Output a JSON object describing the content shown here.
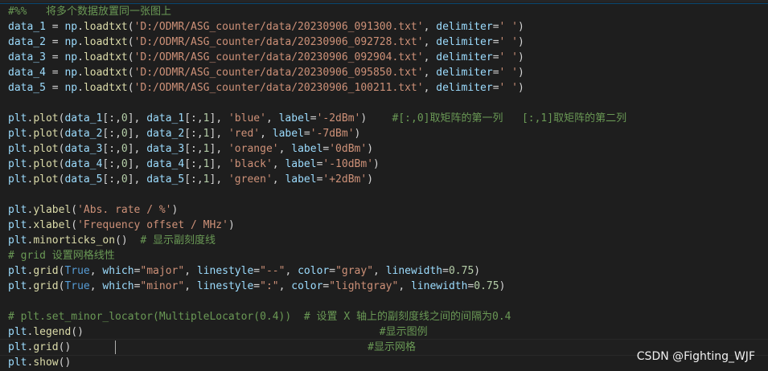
{
  "editor": {
    "lines": [
      [
        {
          "t": "#%%   将多个数据放置同一张图上",
          "c": "c"
        }
      ],
      [
        {
          "t": "data_1",
          "c": "v"
        },
        {
          "t": " = ",
          "c": "p"
        },
        {
          "t": "np",
          "c": "v"
        },
        {
          "t": ".",
          "c": "p"
        },
        {
          "t": "loadtxt",
          "c": "f"
        },
        {
          "t": "(",
          "c": "p"
        },
        {
          "t": "'D:/ODMR/ASG_counter/data/20230906_091300.txt'",
          "c": "s"
        },
        {
          "t": ", ",
          "c": "p"
        },
        {
          "t": "delimiter",
          "c": "v"
        },
        {
          "t": "=",
          "c": "p"
        },
        {
          "t": "' '",
          "c": "s"
        },
        {
          "t": ")",
          "c": "p"
        }
      ],
      [
        {
          "t": "data_2",
          "c": "v"
        },
        {
          "t": " = ",
          "c": "p"
        },
        {
          "t": "np",
          "c": "v"
        },
        {
          "t": ".",
          "c": "p"
        },
        {
          "t": "loadtxt",
          "c": "f"
        },
        {
          "t": "(",
          "c": "p"
        },
        {
          "t": "'D:/ODMR/ASG_counter/data/20230906_092728.txt'",
          "c": "s"
        },
        {
          "t": ", ",
          "c": "p"
        },
        {
          "t": "delimiter",
          "c": "v"
        },
        {
          "t": "=",
          "c": "p"
        },
        {
          "t": "' '",
          "c": "s"
        },
        {
          "t": ")",
          "c": "p"
        }
      ],
      [
        {
          "t": "data_3",
          "c": "v"
        },
        {
          "t": " = ",
          "c": "p"
        },
        {
          "t": "np",
          "c": "v"
        },
        {
          "t": ".",
          "c": "p"
        },
        {
          "t": "loadtxt",
          "c": "f"
        },
        {
          "t": "(",
          "c": "p"
        },
        {
          "t": "'D:/ODMR/ASG_counter/data/20230906_092904.txt'",
          "c": "s"
        },
        {
          "t": ", ",
          "c": "p"
        },
        {
          "t": "delimiter",
          "c": "v"
        },
        {
          "t": "=",
          "c": "p"
        },
        {
          "t": "' '",
          "c": "s"
        },
        {
          "t": ")",
          "c": "p"
        }
      ],
      [
        {
          "t": "data_4",
          "c": "v"
        },
        {
          "t": " = ",
          "c": "p"
        },
        {
          "t": "np",
          "c": "v"
        },
        {
          "t": ".",
          "c": "p"
        },
        {
          "t": "loadtxt",
          "c": "f"
        },
        {
          "t": "(",
          "c": "p"
        },
        {
          "t": "'D:/ODMR/ASG_counter/data/20230906_095850.txt'",
          "c": "s"
        },
        {
          "t": ", ",
          "c": "p"
        },
        {
          "t": "delimiter",
          "c": "v"
        },
        {
          "t": "=",
          "c": "p"
        },
        {
          "t": "' '",
          "c": "s"
        },
        {
          "t": ")",
          "c": "p"
        }
      ],
      [
        {
          "t": "data_5",
          "c": "v"
        },
        {
          "t": " = ",
          "c": "p"
        },
        {
          "t": "np",
          "c": "v"
        },
        {
          "t": ".",
          "c": "p"
        },
        {
          "t": "loadtxt",
          "c": "f"
        },
        {
          "t": "(",
          "c": "p"
        },
        {
          "t": "'D:/ODMR/ASG_counter/data/20230906_100211.txt'",
          "c": "s"
        },
        {
          "t": ", ",
          "c": "p"
        },
        {
          "t": "delimiter",
          "c": "v"
        },
        {
          "t": "=",
          "c": "p"
        },
        {
          "t": "' '",
          "c": "s"
        },
        {
          "t": ")",
          "c": "p"
        }
      ],
      [],
      [
        {
          "t": "plt",
          "c": "v"
        },
        {
          "t": ".",
          "c": "p"
        },
        {
          "t": "plot",
          "c": "f"
        },
        {
          "t": "(",
          "c": "p"
        },
        {
          "t": "data_1",
          "c": "v"
        },
        {
          "t": "[:,",
          "c": "p"
        },
        {
          "t": "0",
          "c": "n"
        },
        {
          "t": "], ",
          "c": "p"
        },
        {
          "t": "data_1",
          "c": "v"
        },
        {
          "t": "[:,",
          "c": "p"
        },
        {
          "t": "1",
          "c": "n"
        },
        {
          "t": "], ",
          "c": "p"
        },
        {
          "t": "'blue'",
          "c": "s"
        },
        {
          "t": ", ",
          "c": "p"
        },
        {
          "t": "label",
          "c": "v"
        },
        {
          "t": "=",
          "c": "p"
        },
        {
          "t": "'-2dBm'",
          "c": "s"
        },
        {
          "t": ")    ",
          "c": "p"
        },
        {
          "t": "#[:,0]取矩阵的第一列   [:,1]取矩阵的第二列",
          "c": "c"
        }
      ],
      [
        {
          "t": "plt",
          "c": "v"
        },
        {
          "t": ".",
          "c": "p"
        },
        {
          "t": "plot",
          "c": "f"
        },
        {
          "t": "(",
          "c": "p"
        },
        {
          "t": "data_2",
          "c": "v"
        },
        {
          "t": "[:,",
          "c": "p"
        },
        {
          "t": "0",
          "c": "n"
        },
        {
          "t": "], ",
          "c": "p"
        },
        {
          "t": "data_2",
          "c": "v"
        },
        {
          "t": "[:,",
          "c": "p"
        },
        {
          "t": "1",
          "c": "n"
        },
        {
          "t": "], ",
          "c": "p"
        },
        {
          "t": "'red'",
          "c": "s"
        },
        {
          "t": ", ",
          "c": "p"
        },
        {
          "t": "label",
          "c": "v"
        },
        {
          "t": "=",
          "c": "p"
        },
        {
          "t": "'-7dBm'",
          "c": "s"
        },
        {
          "t": ")",
          "c": "p"
        }
      ],
      [
        {
          "t": "plt",
          "c": "v"
        },
        {
          "t": ".",
          "c": "p"
        },
        {
          "t": "plot",
          "c": "f"
        },
        {
          "t": "(",
          "c": "p"
        },
        {
          "t": "data_3",
          "c": "v"
        },
        {
          "t": "[:,",
          "c": "p"
        },
        {
          "t": "0",
          "c": "n"
        },
        {
          "t": "], ",
          "c": "p"
        },
        {
          "t": "data_3",
          "c": "v"
        },
        {
          "t": "[:,",
          "c": "p"
        },
        {
          "t": "1",
          "c": "n"
        },
        {
          "t": "], ",
          "c": "p"
        },
        {
          "t": "'orange'",
          "c": "s"
        },
        {
          "t": ", ",
          "c": "p"
        },
        {
          "t": "label",
          "c": "v"
        },
        {
          "t": "=",
          "c": "p"
        },
        {
          "t": "'0dBm'",
          "c": "s"
        },
        {
          "t": ")",
          "c": "p"
        }
      ],
      [
        {
          "t": "plt",
          "c": "v"
        },
        {
          "t": ".",
          "c": "p"
        },
        {
          "t": "plot",
          "c": "f"
        },
        {
          "t": "(",
          "c": "p"
        },
        {
          "t": "data_4",
          "c": "v"
        },
        {
          "t": "[:,",
          "c": "p"
        },
        {
          "t": "0",
          "c": "n"
        },
        {
          "t": "], ",
          "c": "p"
        },
        {
          "t": "data_4",
          "c": "v"
        },
        {
          "t": "[:,",
          "c": "p"
        },
        {
          "t": "1",
          "c": "n"
        },
        {
          "t": "], ",
          "c": "p"
        },
        {
          "t": "'black'",
          "c": "s"
        },
        {
          "t": ", ",
          "c": "p"
        },
        {
          "t": "label",
          "c": "v"
        },
        {
          "t": "=",
          "c": "p"
        },
        {
          "t": "'-10dBm'",
          "c": "s"
        },
        {
          "t": ")",
          "c": "p"
        }
      ],
      [
        {
          "t": "plt",
          "c": "v"
        },
        {
          "t": ".",
          "c": "p"
        },
        {
          "t": "plot",
          "c": "f"
        },
        {
          "t": "(",
          "c": "p"
        },
        {
          "t": "data_5",
          "c": "v"
        },
        {
          "t": "[:,",
          "c": "p"
        },
        {
          "t": "0",
          "c": "n"
        },
        {
          "t": "], ",
          "c": "p"
        },
        {
          "t": "data_5",
          "c": "v"
        },
        {
          "t": "[:,",
          "c": "p"
        },
        {
          "t": "1",
          "c": "n"
        },
        {
          "t": "], ",
          "c": "p"
        },
        {
          "t": "'green'",
          "c": "s"
        },
        {
          "t": ", ",
          "c": "p"
        },
        {
          "t": "label",
          "c": "v"
        },
        {
          "t": "=",
          "c": "p"
        },
        {
          "t": "'+2dBm'",
          "c": "s"
        },
        {
          "t": ")",
          "c": "p"
        }
      ],
      [],
      [
        {
          "t": "plt",
          "c": "v"
        },
        {
          "t": ".",
          "c": "p"
        },
        {
          "t": "ylabel",
          "c": "f"
        },
        {
          "t": "(",
          "c": "p"
        },
        {
          "t": "'Abs. rate / %'",
          "c": "s"
        },
        {
          "t": ")",
          "c": "p"
        }
      ],
      [
        {
          "t": "plt",
          "c": "v"
        },
        {
          "t": ".",
          "c": "p"
        },
        {
          "t": "xlabel",
          "c": "f"
        },
        {
          "t": "(",
          "c": "p"
        },
        {
          "t": "'Frequency offset / MHz'",
          "c": "s"
        },
        {
          "t": ")",
          "c": "p"
        }
      ],
      [
        {
          "t": "plt",
          "c": "v"
        },
        {
          "t": ".",
          "c": "p"
        },
        {
          "t": "minorticks_on",
          "c": "f"
        },
        {
          "t": "()  ",
          "c": "p"
        },
        {
          "t": "# 显示副刻度线",
          "c": "c"
        }
      ],
      [
        {
          "t": "# grid 设置网格线性",
          "c": "c"
        }
      ],
      [
        {
          "t": "plt",
          "c": "v"
        },
        {
          "t": ".",
          "c": "p"
        },
        {
          "t": "grid",
          "c": "f"
        },
        {
          "t": "(",
          "c": "p"
        },
        {
          "t": "True",
          "c": "k"
        },
        {
          "t": ", ",
          "c": "p"
        },
        {
          "t": "which",
          "c": "v"
        },
        {
          "t": "=",
          "c": "p"
        },
        {
          "t": "\"major\"",
          "c": "s"
        },
        {
          "t": ", ",
          "c": "p"
        },
        {
          "t": "linestyle",
          "c": "v"
        },
        {
          "t": "=",
          "c": "p"
        },
        {
          "t": "\"--\"",
          "c": "s"
        },
        {
          "t": ", ",
          "c": "p"
        },
        {
          "t": "color",
          "c": "v"
        },
        {
          "t": "=",
          "c": "p"
        },
        {
          "t": "\"gray\"",
          "c": "s"
        },
        {
          "t": ", ",
          "c": "p"
        },
        {
          "t": "linewidth",
          "c": "v"
        },
        {
          "t": "=",
          "c": "p"
        },
        {
          "t": "0.75",
          "c": "n"
        },
        {
          "t": ")",
          "c": "p"
        }
      ],
      [
        {
          "t": "plt",
          "c": "v"
        },
        {
          "t": ".",
          "c": "p"
        },
        {
          "t": "grid",
          "c": "f"
        },
        {
          "t": "(",
          "c": "p"
        },
        {
          "t": "True",
          "c": "k"
        },
        {
          "t": ", ",
          "c": "p"
        },
        {
          "t": "which",
          "c": "v"
        },
        {
          "t": "=",
          "c": "p"
        },
        {
          "t": "\"minor\"",
          "c": "s"
        },
        {
          "t": ", ",
          "c": "p"
        },
        {
          "t": "linestyle",
          "c": "v"
        },
        {
          "t": "=",
          "c": "p"
        },
        {
          "t": "\":\"",
          "c": "s"
        },
        {
          "t": ", ",
          "c": "p"
        },
        {
          "t": "color",
          "c": "v"
        },
        {
          "t": "=",
          "c": "p"
        },
        {
          "t": "\"lightgray\"",
          "c": "s"
        },
        {
          "t": ", ",
          "c": "p"
        },
        {
          "t": "linewidth",
          "c": "v"
        },
        {
          "t": "=",
          "c": "p"
        },
        {
          "t": "0.75",
          "c": "n"
        },
        {
          "t": ")",
          "c": "p"
        }
      ],
      [],
      [
        {
          "t": "# plt.set_minor_locator(MultipleLocator(0.4))  # 设置 X 轴上的副刻度线之间的间隔为0.4",
          "c": "c"
        }
      ],
      [
        {
          "t": "plt",
          "c": "v"
        },
        {
          "t": ".",
          "c": "p"
        },
        {
          "t": "legend",
          "c": "f"
        },
        {
          "t": "()                                               ",
          "c": "p"
        },
        {
          "t": "#显示图例",
          "c": "c"
        }
      ],
      [
        {
          "t": "plt",
          "c": "v"
        },
        {
          "t": ".",
          "c": "p"
        },
        {
          "t": "grid",
          "c": "f"
        },
        {
          "t": "()       ",
          "c": "p"
        },
        {
          "t": "|CURSOR|",
          "c": "cursor"
        },
        {
          "t": "                                        ",
          "c": "p"
        },
        {
          "t": "#显示网格",
          "c": "c"
        }
      ],
      [
        {
          "t": "plt",
          "c": "v"
        },
        {
          "t": ".",
          "c": "p"
        },
        {
          "t": "show",
          "c": "f"
        },
        {
          "t": "()",
          "c": "p"
        }
      ]
    ],
    "active_line": 22
  },
  "watermark": "CSDN @Fighting_WJF"
}
